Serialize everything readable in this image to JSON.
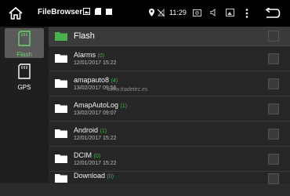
{
  "statusbar": {
    "app_title": "FileBrowser",
    "time": "11:29"
  },
  "sidebar": {
    "items": [
      {
        "label": "Flash",
        "icon": "sd-card-icon",
        "active": true
      },
      {
        "label": "GPS",
        "icon": "gps-card-icon",
        "active": false
      }
    ]
  },
  "main": {
    "header": {
      "title": "Flash"
    },
    "watermark": "www.tradetec.es",
    "rows": [
      {
        "name": "Alarms",
        "count": "(0)",
        "date": "12/01/2017 15:22"
      },
      {
        "name": "amapauto8",
        "count": "(4)",
        "date": "13/02/2017 09:56"
      },
      {
        "name": "AmapAutoLog",
        "count": "(1)",
        "date": "13/02/2017 09:07"
      },
      {
        "name": "Android",
        "count": "(1)",
        "date": "12/01/2017 15:22"
      },
      {
        "name": "DCIM",
        "count": "(0)",
        "date": "12/01/2017 15:22"
      },
      {
        "name": "Download",
        "count": "(0)",
        "date": ""
      }
    ]
  },
  "colors": {
    "accent": "#4caf50",
    "header_folder": "#4caf50"
  }
}
